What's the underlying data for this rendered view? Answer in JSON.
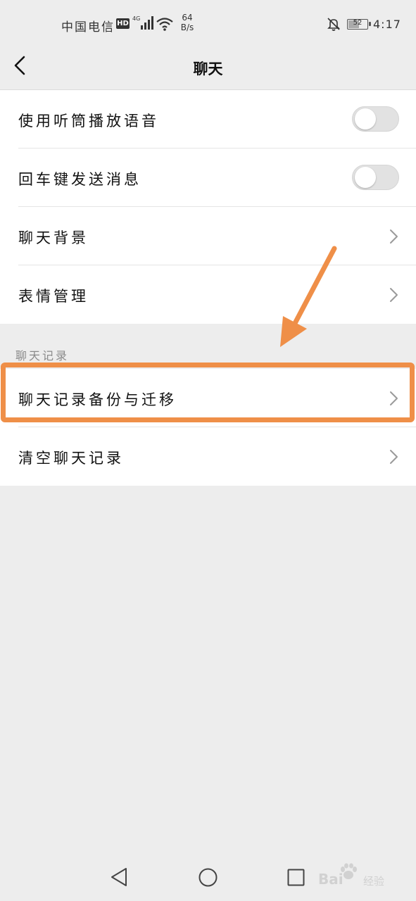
{
  "status_bar": {
    "carrier": "中国电信",
    "hd": "HD",
    "network": "4G",
    "speed_value": "64",
    "speed_unit": "B/s",
    "battery": "52",
    "time": "4:17"
  },
  "header": {
    "title": "聊天",
    "back_icon": "chevron-left-icon"
  },
  "settings": {
    "general": [
      {
        "label": "使用听筒播放语音",
        "control": "toggle",
        "on": false
      },
      {
        "label": "回车键发送消息",
        "control": "toggle",
        "on": false
      },
      {
        "label": "聊天背景",
        "control": "chevron"
      },
      {
        "label": "表情管理",
        "control": "chevron"
      }
    ],
    "history_section_title": "聊天记录",
    "history": [
      {
        "label": "聊天记录备份与迁移",
        "control": "chevron",
        "highlighted": true
      },
      {
        "label": "清空聊天记录",
        "control": "chevron"
      }
    ]
  },
  "annotation": {
    "color": "#ef8f48"
  },
  "watermark": {
    "brand": "Bai",
    "sub": "经验"
  }
}
